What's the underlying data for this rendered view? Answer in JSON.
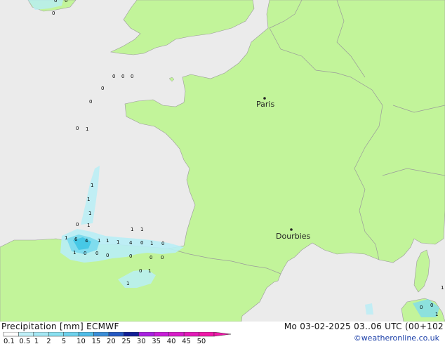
{
  "header": {
    "title": "Precipitation [mm] ECMWF",
    "valid_time": "Mo 03-02-2025 03..06 UTC (00+102",
    "credit": "©weatheronline.co.uk"
  },
  "colors": {
    "sea": "#ebebeb",
    "land": "#c2f49a",
    "border": "#9a9a9a",
    "precip_light": "#b8eef6",
    "precip_mid": "#7fdcee",
    "precip_heavy": "#47c8e6"
  },
  "cities": [
    {
      "name": "Paris"
    },
    {
      "name": "Dourbies"
    }
  ],
  "precip_values": [
    "0",
    "0",
    "0",
    "0",
    "0",
    "0",
    "0",
    "0",
    "0",
    "1",
    "1",
    "1",
    "1",
    "1",
    "0",
    "1",
    "6",
    "4",
    "1",
    "1",
    "1",
    "4",
    "0",
    "1",
    "0",
    "1",
    "1",
    "1",
    "0",
    "0",
    "0",
    "0",
    "0",
    "0",
    "0",
    "1",
    "1",
    "0",
    "0",
    "1",
    "1"
  ],
  "legend": {
    "ticks": [
      "0.1",
      "0.5",
      "1",
      "2",
      "5",
      "10",
      "15",
      "20",
      "25",
      "30",
      "35",
      "40",
      "45",
      "50"
    ],
    "colors": [
      "#fefefe",
      "#bff0f8",
      "#a4e8f4",
      "#89e0f0",
      "#6ed2ec",
      "#50bde8",
      "#3a8ed8",
      "#2458c2",
      "#101e96",
      "#a820e0",
      "#c81ed8",
      "#d81cc8",
      "#e41ab8",
      "#f018a8"
    ]
  }
}
